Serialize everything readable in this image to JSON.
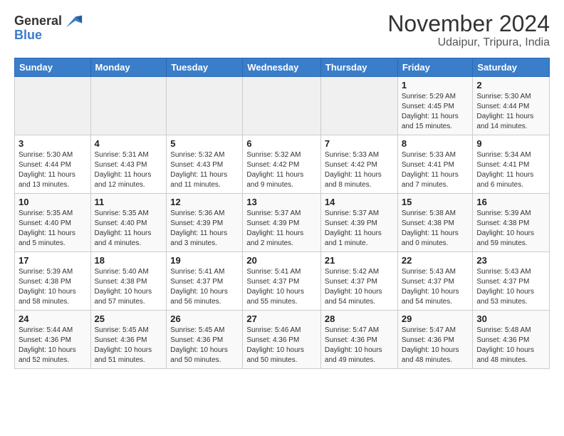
{
  "logo": {
    "general": "General",
    "blue": "Blue"
  },
  "header": {
    "title": "November 2024",
    "subtitle": "Udaipur, Tripura, India"
  },
  "weekdays": [
    "Sunday",
    "Monday",
    "Tuesday",
    "Wednesday",
    "Thursday",
    "Friday",
    "Saturday"
  ],
  "weeks": [
    [
      {
        "day": "",
        "info": ""
      },
      {
        "day": "",
        "info": ""
      },
      {
        "day": "",
        "info": ""
      },
      {
        "day": "",
        "info": ""
      },
      {
        "day": "",
        "info": ""
      },
      {
        "day": "1",
        "info": "Sunrise: 5:29 AM\nSunset: 4:45 PM\nDaylight: 11 hours and 15 minutes."
      },
      {
        "day": "2",
        "info": "Sunrise: 5:30 AM\nSunset: 4:44 PM\nDaylight: 11 hours and 14 minutes."
      }
    ],
    [
      {
        "day": "3",
        "info": "Sunrise: 5:30 AM\nSunset: 4:44 PM\nDaylight: 11 hours and 13 minutes."
      },
      {
        "day": "4",
        "info": "Sunrise: 5:31 AM\nSunset: 4:43 PM\nDaylight: 11 hours and 12 minutes."
      },
      {
        "day": "5",
        "info": "Sunrise: 5:32 AM\nSunset: 4:43 PM\nDaylight: 11 hours and 11 minutes."
      },
      {
        "day": "6",
        "info": "Sunrise: 5:32 AM\nSunset: 4:42 PM\nDaylight: 11 hours and 9 minutes."
      },
      {
        "day": "7",
        "info": "Sunrise: 5:33 AM\nSunset: 4:42 PM\nDaylight: 11 hours and 8 minutes."
      },
      {
        "day": "8",
        "info": "Sunrise: 5:33 AM\nSunset: 4:41 PM\nDaylight: 11 hours and 7 minutes."
      },
      {
        "day": "9",
        "info": "Sunrise: 5:34 AM\nSunset: 4:41 PM\nDaylight: 11 hours and 6 minutes."
      }
    ],
    [
      {
        "day": "10",
        "info": "Sunrise: 5:35 AM\nSunset: 4:40 PM\nDaylight: 11 hours and 5 minutes."
      },
      {
        "day": "11",
        "info": "Sunrise: 5:35 AM\nSunset: 4:40 PM\nDaylight: 11 hours and 4 minutes."
      },
      {
        "day": "12",
        "info": "Sunrise: 5:36 AM\nSunset: 4:39 PM\nDaylight: 11 hours and 3 minutes."
      },
      {
        "day": "13",
        "info": "Sunrise: 5:37 AM\nSunset: 4:39 PM\nDaylight: 11 hours and 2 minutes."
      },
      {
        "day": "14",
        "info": "Sunrise: 5:37 AM\nSunset: 4:39 PM\nDaylight: 11 hours and 1 minute."
      },
      {
        "day": "15",
        "info": "Sunrise: 5:38 AM\nSunset: 4:38 PM\nDaylight: 11 hours and 0 minutes."
      },
      {
        "day": "16",
        "info": "Sunrise: 5:39 AM\nSunset: 4:38 PM\nDaylight: 10 hours and 59 minutes."
      }
    ],
    [
      {
        "day": "17",
        "info": "Sunrise: 5:39 AM\nSunset: 4:38 PM\nDaylight: 10 hours and 58 minutes."
      },
      {
        "day": "18",
        "info": "Sunrise: 5:40 AM\nSunset: 4:38 PM\nDaylight: 10 hours and 57 minutes."
      },
      {
        "day": "19",
        "info": "Sunrise: 5:41 AM\nSunset: 4:37 PM\nDaylight: 10 hours and 56 minutes."
      },
      {
        "day": "20",
        "info": "Sunrise: 5:41 AM\nSunset: 4:37 PM\nDaylight: 10 hours and 55 minutes."
      },
      {
        "day": "21",
        "info": "Sunrise: 5:42 AM\nSunset: 4:37 PM\nDaylight: 10 hours and 54 minutes."
      },
      {
        "day": "22",
        "info": "Sunrise: 5:43 AM\nSunset: 4:37 PM\nDaylight: 10 hours and 54 minutes."
      },
      {
        "day": "23",
        "info": "Sunrise: 5:43 AM\nSunset: 4:37 PM\nDaylight: 10 hours and 53 minutes."
      }
    ],
    [
      {
        "day": "24",
        "info": "Sunrise: 5:44 AM\nSunset: 4:36 PM\nDaylight: 10 hours and 52 minutes."
      },
      {
        "day": "25",
        "info": "Sunrise: 5:45 AM\nSunset: 4:36 PM\nDaylight: 10 hours and 51 minutes."
      },
      {
        "day": "26",
        "info": "Sunrise: 5:45 AM\nSunset: 4:36 PM\nDaylight: 10 hours and 50 minutes."
      },
      {
        "day": "27",
        "info": "Sunrise: 5:46 AM\nSunset: 4:36 PM\nDaylight: 10 hours and 50 minutes."
      },
      {
        "day": "28",
        "info": "Sunrise: 5:47 AM\nSunset: 4:36 PM\nDaylight: 10 hours and 49 minutes."
      },
      {
        "day": "29",
        "info": "Sunrise: 5:47 AM\nSunset: 4:36 PM\nDaylight: 10 hours and 48 minutes."
      },
      {
        "day": "30",
        "info": "Sunrise: 5:48 AM\nSunset: 4:36 PM\nDaylight: 10 hours and 48 minutes."
      }
    ]
  ]
}
